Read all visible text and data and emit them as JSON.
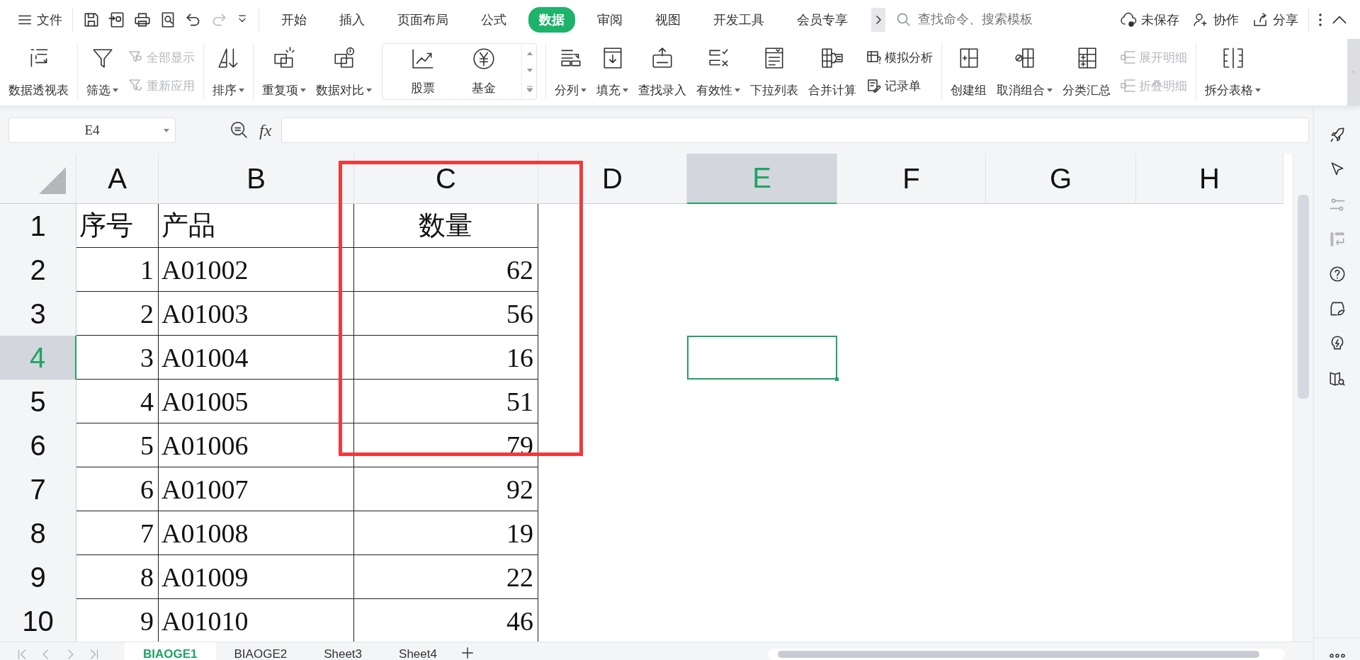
{
  "file_menu": {
    "label": "文件"
  },
  "tabs": [
    {
      "label": "开始",
      "selected": false
    },
    {
      "label": "插入",
      "selected": false
    },
    {
      "label": "页面布局",
      "selected": false
    },
    {
      "label": "公式",
      "selected": false
    },
    {
      "label": "数据",
      "selected": true
    },
    {
      "label": "审阅",
      "selected": false
    },
    {
      "label": "视图",
      "selected": false
    },
    {
      "label": "开发工具",
      "selected": false
    },
    {
      "label": "会员专享",
      "selected": false
    }
  ],
  "search": {
    "placeholder": "查找命令、搜索模板"
  },
  "actions": [
    {
      "label": "未保存"
    },
    {
      "label": "协作"
    },
    {
      "label": "分享"
    }
  ],
  "ribbon": [
    {
      "items": [
        {
          "kind": "large",
          "label": "数据透视表",
          "dropdown": false
        }
      ]
    },
    {
      "items": [
        {
          "kind": "large",
          "label": "筛选",
          "dropdown": true
        },
        {
          "kind": "stack",
          "items": [
            {
              "label": "全部显示",
              "disabled": true
            },
            {
              "label": "重新应用",
              "disabled": true
            }
          ]
        }
      ]
    },
    {
      "items": [
        {
          "kind": "large",
          "label": "排序",
          "dropdown": true
        }
      ]
    },
    {
      "items": [
        {
          "kind": "large",
          "label": "重复项",
          "dropdown": true
        },
        {
          "kind": "large",
          "label": "数据对比",
          "dropdown": true
        },
        {
          "kind": "gallery",
          "items": [
            {
              "label": "股票"
            },
            {
              "label": "基金"
            }
          ]
        }
      ]
    },
    {
      "items": [
        {
          "kind": "large",
          "label": "分列",
          "dropdown": true
        },
        {
          "kind": "large",
          "label": "填充",
          "dropdown": true
        },
        {
          "kind": "large",
          "label": "查找录入",
          "dropdown": false
        },
        {
          "kind": "large",
          "label": "有效性",
          "dropdown": true
        },
        {
          "kind": "large",
          "label": "下拉列表",
          "dropdown": false
        },
        {
          "kind": "large",
          "label": "合并计算",
          "dropdown": false
        },
        {
          "kind": "stack",
          "items": [
            {
              "label": "模拟分析",
              "disabled": false
            },
            {
              "label": "记录单",
              "disabled": false
            }
          ]
        }
      ]
    },
    {
      "items": [
        {
          "kind": "large",
          "label": "创建组",
          "dropdown": false
        },
        {
          "kind": "large",
          "label": "取消组合",
          "dropdown": true
        },
        {
          "kind": "large",
          "label": "分类汇总",
          "dropdown": false
        },
        {
          "kind": "stack",
          "items": [
            {
              "label": "展开明细",
              "disabled": true
            },
            {
              "label": "折叠明细",
              "disabled": true
            }
          ]
        }
      ]
    },
    {
      "items": [
        {
          "kind": "large",
          "label": "拆分表格",
          "dropdown": true
        }
      ]
    }
  ],
  "name_box": {
    "value": "E4"
  },
  "formula_bar": {
    "label": "fx"
  },
  "columns": [
    {
      "label": "A",
      "selected": false
    },
    {
      "label": "B",
      "selected": false
    },
    {
      "label": "C",
      "selected": false
    },
    {
      "label": "D",
      "selected": false
    },
    {
      "label": "E",
      "selected": true
    },
    {
      "label": "F",
      "selected": false
    },
    {
      "label": "G",
      "selected": false
    },
    {
      "label": "H",
      "selected": false
    }
  ],
  "rows": [
    {
      "label": "1",
      "selected": false,
      "cells": [
        {
          "text": "序号",
          "kind": "text"
        },
        {
          "text": "产品",
          "kind": "text"
        },
        {
          "text": "数量",
          "kind": "title"
        }
      ]
    },
    {
      "label": "2",
      "selected": false,
      "cells": [
        {
          "text": "1",
          "kind": "number"
        },
        {
          "text": "A01002",
          "kind": "text"
        },
        {
          "text": "62",
          "kind": "number"
        }
      ]
    },
    {
      "label": "3",
      "selected": false,
      "cells": [
        {
          "text": "2",
          "kind": "number"
        },
        {
          "text": "A01003",
          "kind": "text"
        },
        {
          "text": "56",
          "kind": "number"
        }
      ]
    },
    {
      "label": "4",
      "selected": true,
      "cells": [
        {
          "text": "3",
          "kind": "number"
        },
        {
          "text": "A01004",
          "kind": "text"
        },
        {
          "text": "16",
          "kind": "number"
        }
      ]
    },
    {
      "label": "5",
      "selected": false,
      "cells": [
        {
          "text": "4",
          "kind": "number"
        },
        {
          "text": "A01005",
          "kind": "text"
        },
        {
          "text": "51",
          "kind": "number"
        }
      ]
    },
    {
      "label": "6",
      "selected": false,
      "cells": [
        {
          "text": "5",
          "kind": "number"
        },
        {
          "text": "A01006",
          "kind": "text"
        },
        {
          "text": "79",
          "kind": "number"
        }
      ]
    },
    {
      "label": "7",
      "selected": false,
      "cells": [
        {
          "text": "6",
          "kind": "number"
        },
        {
          "text": "A01007",
          "kind": "text"
        },
        {
          "text": "92",
          "kind": "number"
        }
      ]
    },
    {
      "label": "8",
      "selected": false,
      "cells": [
        {
          "text": "7",
          "kind": "number"
        },
        {
          "text": "A01008",
          "kind": "text"
        },
        {
          "text": "19",
          "kind": "number"
        }
      ]
    },
    {
      "label": "9",
      "selected": false,
      "cells": [
        {
          "text": "8",
          "kind": "number"
        },
        {
          "text": "A01009",
          "kind": "text"
        },
        {
          "text": "22",
          "kind": "number"
        }
      ]
    },
    {
      "label": "10",
      "selected": false,
      "cells": [
        {
          "text": "9",
          "kind": "number"
        },
        {
          "text": "A01010",
          "kind": "text"
        },
        {
          "text": "46",
          "kind": "number"
        }
      ]
    }
  ],
  "highlight": {
    "color": "#f0393c"
  },
  "sheets": [
    {
      "label": "BIAOGE1",
      "selected": true
    },
    {
      "label": "BIAOGE2",
      "selected": false
    },
    {
      "label": "Sheet3",
      "selected": false
    },
    {
      "label": "Sheet4",
      "selected": false
    }
  ]
}
